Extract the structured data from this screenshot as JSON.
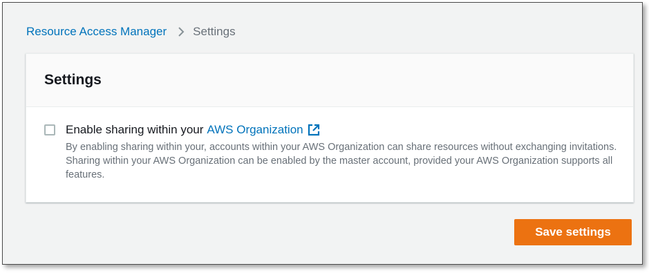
{
  "breadcrumb": {
    "root_label": "Resource Access Manager",
    "separator_icon": "chevron-right-icon",
    "current_label": "Settings"
  },
  "settings_panel": {
    "title": "Settings",
    "option": {
      "checked": false,
      "label_prefix": "Enable sharing within your",
      "label_link": "AWS Organization",
      "link_icon": "external-link-icon",
      "description": "By enabling sharing within your, accounts within your AWS Organization can share resources without exchanging invitations. Sharing within your AWS Organization can be enabled by the master account, provided your AWS Organization supports all features."
    }
  },
  "actions": {
    "save_label": "Save settings"
  },
  "colors": {
    "link": "#0073bb",
    "primary_button": "#ec7211",
    "page_background": "#f2f3f3"
  }
}
